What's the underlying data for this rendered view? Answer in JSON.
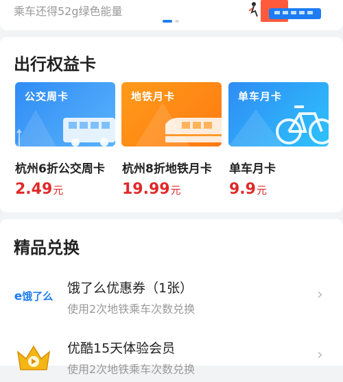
{
  "banner": {
    "subtitle": "乘车还得52g绿色能量",
    "carousel_dots": 2,
    "active_dot": 0
  },
  "benefit_cards": {
    "title": "出行权益卡",
    "cards": [
      {
        "label": "公交周卡",
        "name": "杭州6折公交周卡",
        "price": "2.49",
        "unit": "元",
        "theme": "blue",
        "icon": "bus-icon"
      },
      {
        "label": "地铁月卡",
        "name": "杭州8折地铁月卡",
        "price": "19.99",
        "unit": "元",
        "theme": "orange",
        "icon": "metro-icon"
      },
      {
        "label": "单车月卡",
        "name": "单车月卡",
        "price": "9.9",
        "unit": "元",
        "theme": "cyan",
        "icon": "bicycle-icon"
      }
    ]
  },
  "exchange": {
    "title": "精品兑换",
    "items": [
      {
        "title": "饿了么优惠券（1张）",
        "subtitle": "使用2次地铁乘车次数兑换",
        "logo_text": "饿了么",
        "logo": "eleme-logo"
      },
      {
        "title": "优酷15天体验会员",
        "subtitle": "使用2次地铁乘车次数兑换",
        "logo": "youku-crown-logo"
      }
    ]
  },
  "colors": {
    "accent_blue": "#1e7cf3",
    "price_red": "#e02929",
    "card_orange": "#ff8a16",
    "card_blue": "#3a96f7"
  }
}
